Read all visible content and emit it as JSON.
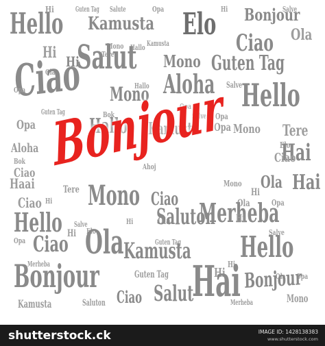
{
  "words": [
    {
      "text": "Hello",
      "size": "xl",
      "tone": "mid"
    },
    {
      "text": "Hi",
      "size": "s",
      "tone": "light"
    },
    {
      "text": "Guten Tag",
      "size": "xs",
      "tone": "light"
    },
    {
      "text": "Salute",
      "size": "xs",
      "tone": "light"
    },
    {
      "text": "Opa",
      "size": "xs",
      "tone": "light"
    },
    {
      "text": "Kamusta",
      "size": "l",
      "tone": "mid"
    },
    {
      "text": "Elo",
      "size": "xl",
      "tone": "dark"
    },
    {
      "text": "Hi",
      "size": "xs",
      "tone": "light"
    },
    {
      "text": "Bonjour",
      "size": "l",
      "tone": "mid"
    },
    {
      "text": "Salve",
      "size": "xs",
      "tone": "light"
    },
    {
      "text": "Ola",
      "size": "m",
      "tone": "light"
    },
    {
      "text": "Ciao",
      "size": "l",
      "tone": "mid"
    },
    {
      "text": "Hi",
      "size": "s",
      "tone": "light"
    },
    {
      "text": "Ola",
      "size": "xs",
      "tone": "light"
    },
    {
      "text": "Mono",
      "size": "xs",
      "tone": "light"
    },
    {
      "text": "Tere",
      "size": "xs",
      "tone": "light"
    },
    {
      "text": "Hallo",
      "size": "xs",
      "tone": "light"
    },
    {
      "text": "Kamusta",
      "size": "xs",
      "tone": "light"
    },
    {
      "text": "Hi",
      "size": "m",
      "tone": "mid"
    },
    {
      "text": "Salut",
      "size": "xl",
      "tone": "mid"
    },
    {
      "text": "Mono",
      "size": "m",
      "tone": "mid"
    },
    {
      "text": "Guten Tag",
      "size": "l",
      "tone": "mid"
    },
    {
      "text": "Ciao",
      "size": "xxl",
      "tone": "mid"
    },
    {
      "text": "Opa",
      "size": "xs",
      "tone": "light"
    },
    {
      "text": "Hallo",
      "size": "xs",
      "tone": "light"
    },
    {
      "text": "Aloha",
      "size": "l",
      "tone": "mid"
    },
    {
      "text": "Salve",
      "size": "xs",
      "tone": "light"
    },
    {
      "text": "Hello",
      "size": "xl",
      "tone": "mid"
    },
    {
      "text": "Mono",
      "size": "m",
      "tone": "mid"
    },
    {
      "text": "Guten Tag",
      "size": "xs",
      "tone": "light"
    },
    {
      "text": "Bok",
      "size": "xs",
      "tone": "light"
    },
    {
      "text": "Opa",
      "size": "xs",
      "tone": "light"
    },
    {
      "text": "Opa",
      "size": "s",
      "tone": "light"
    },
    {
      "text": "Hallo",
      "size": "m",
      "tone": "mid"
    },
    {
      "text": "Kamusta",
      "size": "m",
      "tone": "mid"
    },
    {
      "text": "Salve",
      "size": "xs",
      "tone": "light"
    },
    {
      "text": "Opa",
      "size": "xs",
      "tone": "light"
    },
    {
      "text": "Opa",
      "size": "xs",
      "tone": "light"
    },
    {
      "text": "Mono",
      "size": "s",
      "tone": "light"
    },
    {
      "text": "Tere",
      "size": "s",
      "tone": "light"
    },
    {
      "text": "Aloha",
      "size": "s",
      "tone": "light"
    },
    {
      "text": "Bok",
      "size": "xs",
      "tone": "light"
    },
    {
      "text": "Elo",
      "size": "xs",
      "tone": "light"
    },
    {
      "text": "Ciao",
      "size": "s",
      "tone": "light"
    },
    {
      "text": "Hai",
      "size": "m",
      "tone": "mid"
    },
    {
      "text": "Bonjour",
      "size": "hero",
      "tone": "red"
    },
    {
      "text": "Ciao",
      "size": "s",
      "tone": "light"
    },
    {
      "text": "Ahoj",
      "size": "xs",
      "tone": "light"
    },
    {
      "text": "Haai",
      "size": "s",
      "tone": "light"
    },
    {
      "text": "Hi",
      "size": "xs",
      "tone": "light"
    },
    {
      "text": "Ciao",
      "size": "s",
      "tone": "light"
    },
    {
      "text": "Mono",
      "size": "xs",
      "tone": "light"
    },
    {
      "text": "Ola",
      "size": "m",
      "tone": "mid"
    },
    {
      "text": "Hai",
      "size": "m",
      "tone": "mid"
    },
    {
      "text": "Ola",
      "size": "s",
      "tone": "light"
    },
    {
      "text": "Hi",
      "size": "xs",
      "tone": "light"
    },
    {
      "text": "Opa",
      "size": "xs",
      "tone": "light"
    },
    {
      "text": "Tere",
      "size": "xs",
      "tone": "light"
    },
    {
      "text": "Mono",
      "size": "l",
      "tone": "mid"
    },
    {
      "text": "Ciao",
      "size": "m",
      "tone": "mid"
    },
    {
      "text": "Merheba",
      "size": "l",
      "tone": "mid"
    },
    {
      "text": "Hello",
      "size": "l",
      "tone": "mid"
    },
    {
      "text": "Salve",
      "size": "xs",
      "tone": "light"
    },
    {
      "text": "Hi",
      "size": "xs",
      "tone": "light"
    },
    {
      "text": "Ola",
      "size": "s",
      "tone": "light"
    },
    {
      "text": "Saluton",
      "size": "m",
      "tone": "mid"
    },
    {
      "text": "Hi",
      "size": "s",
      "tone": "light"
    },
    {
      "text": "Elo",
      "size": "xs",
      "tone": "light"
    },
    {
      "text": "Hi",
      "size": "s",
      "tone": "light"
    },
    {
      "text": "Salve",
      "size": "xs",
      "tone": "light"
    },
    {
      "text": "Opa",
      "size": "xs",
      "tone": "light"
    },
    {
      "text": "Ciao",
      "size": "m",
      "tone": "mid"
    },
    {
      "text": "Ola",
      "size": "l",
      "tone": "mid"
    },
    {
      "text": "Guten Tag",
      "size": "xs",
      "tone": "light"
    },
    {
      "text": "Kamusta",
      "size": "m",
      "tone": "mid"
    },
    {
      "text": "Hello",
      "size": "l",
      "tone": "mid"
    },
    {
      "text": "Merheba",
      "size": "xs",
      "tone": "light"
    },
    {
      "text": "Hi",
      "size": "xs",
      "tone": "light"
    },
    {
      "text": "Bonjour",
      "size": "xl",
      "tone": "mid"
    },
    {
      "text": "Guten Tag",
      "size": "s",
      "tone": "light"
    },
    {
      "text": "Hi",
      "size": "s",
      "tone": "light"
    },
    {
      "text": "Opa",
      "size": "xs",
      "tone": "light"
    },
    {
      "text": "Ola",
      "size": "xs",
      "tone": "light"
    },
    {
      "text": "Hai",
      "size": "l",
      "tone": "mid"
    },
    {
      "text": "Bonjour",
      "size": "m",
      "tone": "mid"
    },
    {
      "text": "Salut",
      "size": "m",
      "tone": "mid"
    },
    {
      "text": "Kamusta",
      "size": "s",
      "tone": "light"
    },
    {
      "text": "Saluton",
      "size": "xs",
      "tone": "light"
    },
    {
      "text": "Ciao",
      "size": "m",
      "tone": "mid"
    },
    {
      "text": "Merheba",
      "size": "xs",
      "tone": "light"
    },
    {
      "text": "Mono",
      "size": "s",
      "tone": "light"
    }
  ],
  "colors": {
    "background": "#ffffff",
    "gray_light": "#9d9d9d",
    "gray_mid": "#8a8a8a",
    "gray_dark": "#6e6e6e",
    "accent_red": "#e8231f"
  },
  "footer": {
    "logo": "shutterstock.ck",
    "image_id": "IMAGE ID: 1428138383",
    "site": "www.shutterstock.com"
  }
}
